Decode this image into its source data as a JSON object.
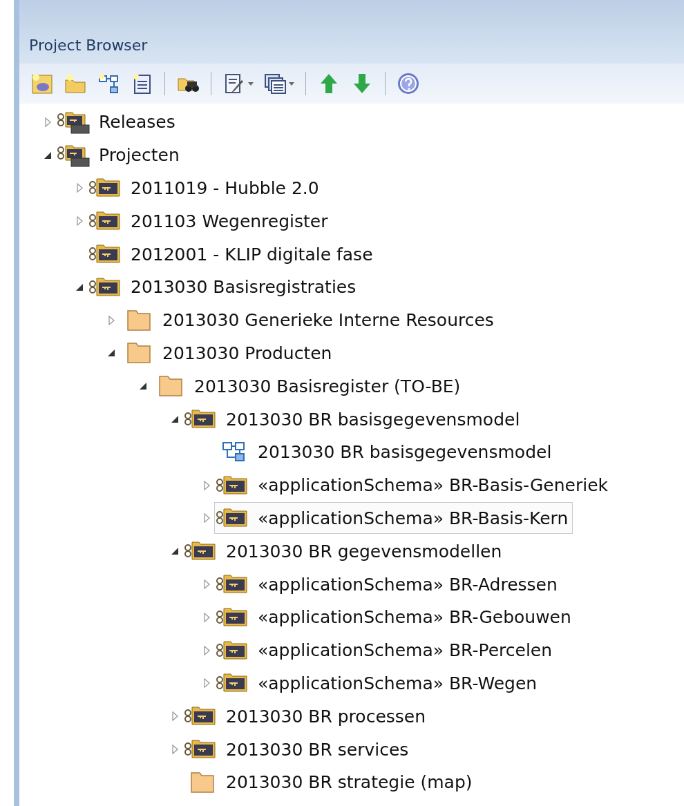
{
  "panel": {
    "title": "Project Browser"
  },
  "toolbar": [
    {
      "kind": "new-model"
    },
    {
      "kind": "new-package"
    },
    {
      "kind": "new-diagram"
    },
    {
      "kind": "new-element"
    },
    {
      "kind": "separator"
    },
    {
      "kind": "find"
    },
    {
      "kind": "separator"
    },
    {
      "kind": "notes",
      "dropdown": true
    },
    {
      "kind": "windows",
      "dropdown": true
    },
    {
      "kind": "separator"
    },
    {
      "kind": "up"
    },
    {
      "kind": "down"
    },
    {
      "kind": "separator"
    },
    {
      "kind": "help"
    }
  ],
  "tree": [
    {
      "label": "Releases",
      "kind": "model",
      "expandable": true,
      "expanded": false,
      "selected": false
    },
    {
      "label": "Projecten",
      "kind": "model",
      "expandable": true,
      "expanded": true,
      "selected": false,
      "children": [
        {
          "label": "2011019 - Hubble 2.0",
          "kind": "package",
          "expandable": true,
          "expanded": false,
          "selected": false
        },
        {
          "label": "201103 Wegenregister",
          "kind": "package",
          "expandable": true,
          "expanded": false,
          "selected": false
        },
        {
          "label": "2012001 - KLIP digitale fase",
          "kind": "package",
          "expandable": false,
          "selected": false
        },
        {
          "label": "2013030 Basisregistraties",
          "kind": "package",
          "expandable": true,
          "expanded": true,
          "selected": false,
          "children": [
            {
              "label": "2013030 Generieke Interne Resources",
              "kind": "folder",
              "expandable": true,
              "expanded": false,
              "selected": false
            },
            {
              "label": "2013030 Producten",
              "kind": "folder",
              "expandable": true,
              "expanded": true,
              "selected": false,
              "children": [
                {
                  "label": "2013030 Basisregister (TO-BE)",
                  "kind": "folder",
                  "expandable": true,
                  "expanded": true,
                  "selected": false,
                  "children": [
                    {
                      "label": "2013030 BR basisgegevensmodel",
                      "kind": "package",
                      "expandable": true,
                      "expanded": true,
                      "selected": false,
                      "children": [
                        {
                          "label": "2013030 BR basisgegevensmodel",
                          "kind": "diagram",
                          "expandable": false,
                          "selected": false
                        },
                        {
                          "label": "«applicationSchema» BR-Basis-Generiek",
                          "kind": "package",
                          "expandable": true,
                          "expanded": false,
                          "selected": false
                        },
                        {
                          "label": "«applicationSchema» BR-Basis-Kern",
                          "kind": "package",
                          "expandable": true,
                          "expanded": false,
                          "selected": true
                        }
                      ]
                    },
                    {
                      "label": "2013030 BR gegevensmodellen",
                      "kind": "package",
                      "expandable": true,
                      "expanded": true,
                      "selected": false,
                      "children": [
                        {
                          "label": "«applicationSchema» BR-Adressen",
                          "kind": "package",
                          "expandable": true,
                          "expanded": false,
                          "selected": false
                        },
                        {
                          "label": "«applicationSchema» BR-Gebouwen",
                          "kind": "package",
                          "expandable": true,
                          "expanded": false,
                          "selected": false
                        },
                        {
                          "label": "«applicationSchema» BR-Percelen",
                          "kind": "package",
                          "expandable": true,
                          "expanded": false,
                          "selected": false
                        },
                        {
                          "label": "«applicationSchema» BR-Wegen",
                          "kind": "package",
                          "expandable": true,
                          "expanded": false,
                          "selected": false
                        }
                      ]
                    },
                    {
                      "label": "2013030 BR processen",
                      "kind": "package",
                      "expandable": true,
                      "expanded": false,
                      "selected": false
                    },
                    {
                      "label": "2013030 BR services",
                      "kind": "package",
                      "expandable": true,
                      "expanded": false,
                      "selected": false
                    },
                    {
                      "label": "2013030 BR strategie (map)",
                      "kind": "folder",
                      "expandable": false,
                      "selected": false
                    }
                  ]
                }
              ]
            }
          ]
        }
      ]
    }
  ]
}
